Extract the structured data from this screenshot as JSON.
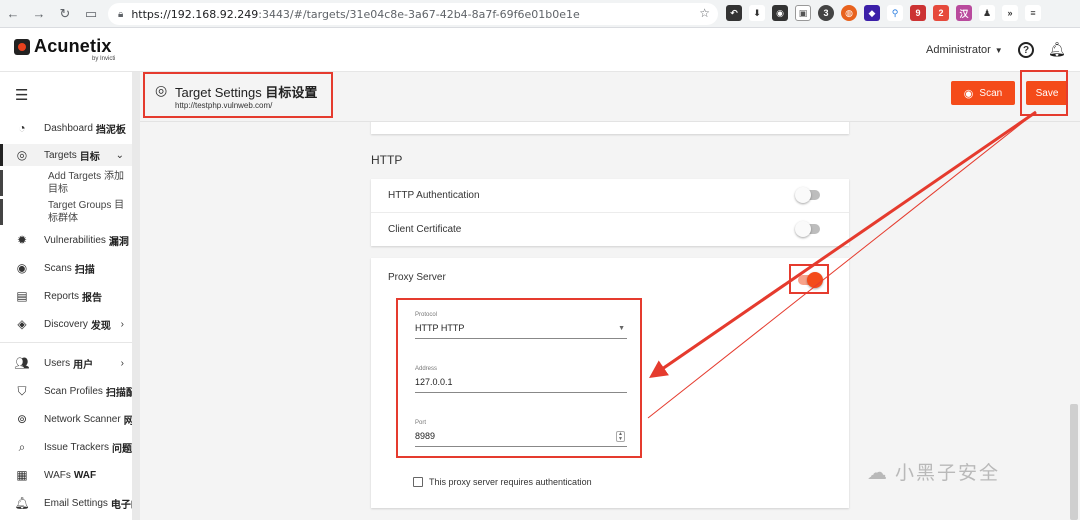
{
  "browser": {
    "url_host": "https://192.168.92.249",
    "url_rest": ":3443/#/targets/31e04c8e-3a67-42b4-8a7f-69f6e01b0e1e",
    "ext_badge": "9",
    "ext_labels": [
      "3",
      "2",
      "汉"
    ]
  },
  "app": {
    "logo": "Acunetix",
    "logo_sub": "by Invicti",
    "user": "Administrator"
  },
  "sidebar": {
    "items": [
      {
        "label": "Dashboard",
        "cn": "挡泥板",
        "icon": "dashboard-icon"
      },
      {
        "label": "Targets",
        "cn": "目标",
        "icon": "target-icon"
      },
      {
        "label": "Vulnerabilities",
        "cn": "漏洞",
        "icon": "bug-icon"
      },
      {
        "label": "Scans",
        "cn": "扫描",
        "icon": "scan-icon"
      },
      {
        "label": "Reports",
        "cn": "报告",
        "icon": "report-icon"
      },
      {
        "label": "Discovery",
        "cn": "发现",
        "icon": "compass-icon"
      },
      {
        "label": "Users",
        "cn": "用户",
        "icon": "users-icon"
      },
      {
        "label": "Scan Profiles",
        "cn": "扫描配",
        "icon": "shield-icon"
      },
      {
        "label": "Network Scanner",
        "cn": "网络",
        "icon": "network-icon"
      },
      {
        "label": "Issue Trackers",
        "cn": "问题跟",
        "icon": "tracker-icon"
      },
      {
        "label": "WAFs",
        "cn": "WAF",
        "icon": "waf-icon"
      },
      {
        "label": "Email Settings",
        "cn": "电子邮",
        "icon": "bell-icon"
      }
    ],
    "sub_add_1": "Add Targets 添加",
    "sub_add_2": "目标",
    "sub_groups_1": "Target Groups 目",
    "sub_groups_2": "标群体"
  },
  "page": {
    "title": "Target Settings",
    "title_cn": "目标设置",
    "url": "http://testphp.vulnweb.com/",
    "scan_label": "Scan",
    "save_label": "Save"
  },
  "http": {
    "section": "HTTP",
    "auth_label": "HTTP Authentication",
    "auth_on": false,
    "cert_label": "Client Certificate",
    "cert_on": false
  },
  "proxy": {
    "label": "Proxy Server",
    "enabled": true,
    "protocol_label": "Protocol",
    "protocol_value": "HTTP HTTP",
    "address_label": "Address",
    "address_value": "127.0.0.1",
    "port_label": "Port",
    "port_value": "8989",
    "auth_label": "This proxy server requires authentication",
    "auth_checked": false
  },
  "watermark": "小黑子安全",
  "colors": {
    "accent": "#f44b1a",
    "annotation": "#e53b2e"
  }
}
